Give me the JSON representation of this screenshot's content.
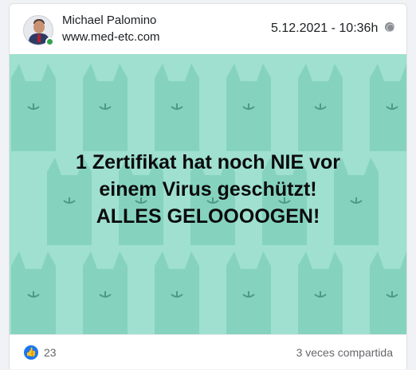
{
  "post": {
    "author_name": "Michael Palomino",
    "author_site": "www.med-etc.com",
    "timestamp": "5.12.2021 - 10:36h",
    "visibility_icon": "globe-icon",
    "online_status_color": "#31a24c"
  },
  "image": {
    "background_color": "#9fe0d0",
    "pattern": "cat-silhouettes",
    "headline_lines": [
      "1 Zertifikat hat noch NIE vor",
      "einem Virus geschützt!",
      "ALLES GELOOOOGEN!"
    ]
  },
  "reactions": {
    "like_icon": "thumbs-up-icon",
    "like_color": "#1877f2",
    "count": "23",
    "shares_text": "3 veces compartida"
  }
}
